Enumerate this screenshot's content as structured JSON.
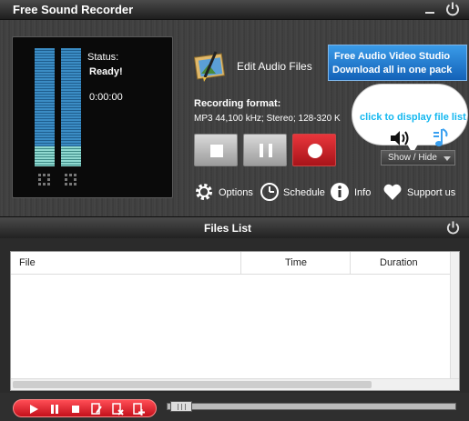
{
  "app": {
    "title": "Free Sound Recorder"
  },
  "status": {
    "label": "Status:",
    "value": "Ready!",
    "time": "0:00:00"
  },
  "actions": {
    "edit_label": "Edit Audio Files"
  },
  "ad": {
    "line1": "Free Audio Video Studio",
    "line2": "Download all in one pack"
  },
  "format": {
    "label": "Recording format:",
    "value": "MP3 44,100 kHz; Stereo;  128-320 K"
  },
  "tooltip": {
    "text": "click to display file list"
  },
  "show_hide": {
    "label": "Show / Hide"
  },
  "options": [
    {
      "label": "Options",
      "icon": "gear-icon"
    },
    {
      "label": "Schedule",
      "icon": "clock-icon"
    },
    {
      "label": "Info",
      "icon": "info-icon"
    },
    {
      "label": "Support us",
      "icon": "heart-icon"
    }
  ],
  "files_list": {
    "title": "Files List",
    "columns": [
      "File",
      "Time",
      "Duration"
    ]
  },
  "colors": {
    "record": "#d6222a",
    "accent_blue": "#1f7bd4",
    "tooltip_text": "#14b8f0"
  }
}
